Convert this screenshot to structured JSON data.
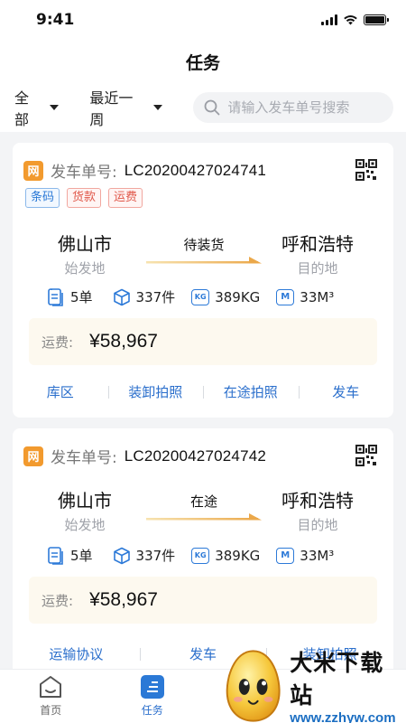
{
  "status_bar": {
    "time": "9:41"
  },
  "header": {
    "title": "任务"
  },
  "filters": {
    "status_select": "全部",
    "period_select": "最近一周",
    "search_placeholder": "请输入发车单号搜索"
  },
  "tasks": [
    {
      "badge": "网",
      "order_label": "发车单号:",
      "order_no": "LC20200427024741",
      "tags": [
        "条码",
        "货款",
        "运费"
      ],
      "from_city": "佛山市",
      "from_label": "始发地",
      "status": "待装货",
      "to_city": "呼和浩特",
      "to_label": "目的地",
      "stats": {
        "orders": "5单",
        "pieces": "337件",
        "weight": "389KG",
        "volume": "33M³"
      },
      "fee_label": "运费:",
      "fee": "¥58,967",
      "actions": [
        "库区",
        "装卸拍照",
        "在途拍照",
        "发车"
      ]
    },
    {
      "badge": "网",
      "order_label": "发车单号:",
      "order_no": "LC20200427024742",
      "from_city": "佛山市",
      "from_label": "始发地",
      "status": "在途",
      "to_city": "呼和浩特",
      "to_label": "目的地",
      "stats": {
        "orders": "5单",
        "pieces": "337件",
        "weight": "389KG",
        "volume": "33M³"
      },
      "fee_label": "运费:",
      "fee": "¥58,967",
      "actions": [
        "运输协议",
        "发车",
        "装卸拍照"
      ]
    }
  ],
  "icons": {
    "kg": "KG",
    "m": "M"
  },
  "tabbar": {
    "home": "首页",
    "tasks": "任务"
  },
  "watermark": {
    "title": "大米下载站",
    "url": "www.zzhyw.com"
  },
  "colors": {
    "accent": "#2b6fcc",
    "badge": "#f29a2e",
    "fee_bg": "#fdf9ef"
  }
}
